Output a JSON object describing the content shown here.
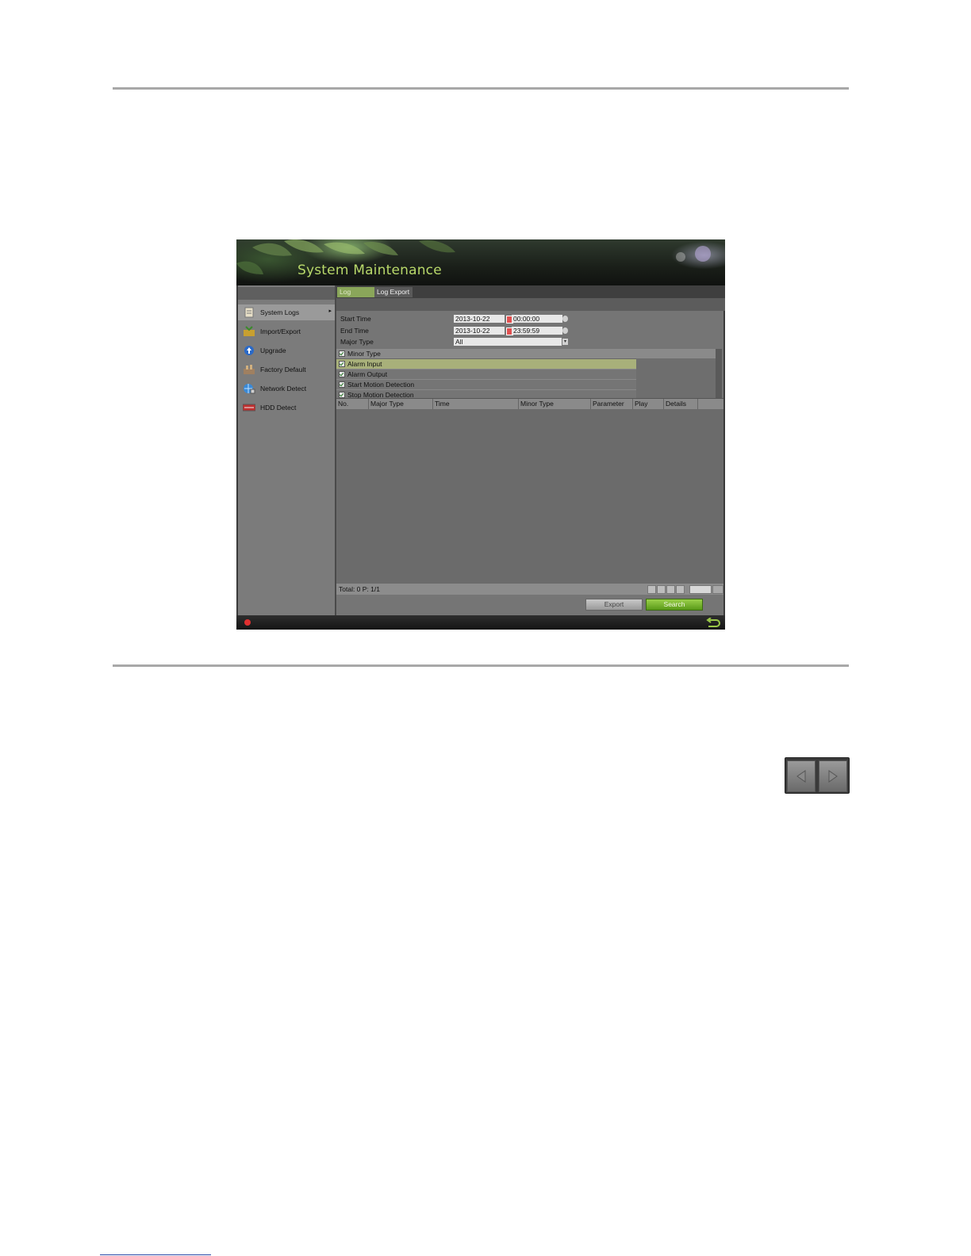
{
  "window": {
    "title": "System Maintenance"
  },
  "sidebar": {
    "items": [
      {
        "label": "System Logs",
        "icon": "document-icon"
      },
      {
        "label": "Import/Export",
        "icon": "import-export-icon"
      },
      {
        "label": "Upgrade",
        "icon": "upgrade-icon"
      },
      {
        "label": "Factory Default",
        "icon": "factory-default-icon"
      },
      {
        "label": "Network Detect",
        "icon": "network-icon"
      },
      {
        "label": "HDD Detect",
        "icon": "hdd-icon"
      }
    ],
    "selected_arrow": "▸"
  },
  "tabs": [
    {
      "label": "Log Search"
    },
    {
      "label": "Log Export"
    }
  ],
  "form": {
    "start_time_label": "Start Time",
    "start_date": "2013-10-22",
    "start_time": "00:00:00",
    "end_time_label": "End Time",
    "end_date": "2013-10-22",
    "end_time": "23:59:59",
    "major_type_label": "Major Type",
    "major_type_value": "All",
    "minor_type_header": "Minor Type",
    "minor_types": [
      "Alarm Input",
      "Alarm Output",
      "Start Motion Detection",
      "Stop Motion Detection"
    ]
  },
  "table": {
    "columns": [
      "No.",
      "Major Type",
      "Time",
      "Minor Type",
      "Parameter",
      "Play",
      "Details"
    ]
  },
  "footer": {
    "total_text": "Total: 0  P: 1/1"
  },
  "buttons": {
    "export": "Export",
    "search": "Search"
  },
  "colors": {
    "accent_green": "#8aa65a",
    "title_green": "#b8d86a",
    "search_green": "#5a9a18",
    "record_red": "#e03030"
  }
}
